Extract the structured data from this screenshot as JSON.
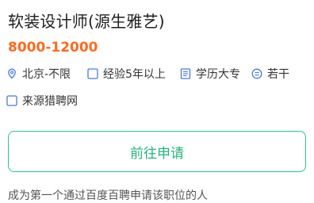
{
  "job": {
    "title": "软装设计师(源生雅艺)",
    "salary": "8000-12000"
  },
  "tags": {
    "location": "北京-不限",
    "experience": "经验5年以上",
    "education": "学历大专",
    "headcount": "若干",
    "source": "来源猎聘网"
  },
  "apply_button": {
    "label": "前往申请"
  },
  "footer": {
    "text": "成为第一个通过百度百聘申请该职位的人"
  },
  "colors": {
    "accent": "#2ec28a",
    "salary": "#ff6a1f",
    "icon": "#4a7bd6"
  }
}
